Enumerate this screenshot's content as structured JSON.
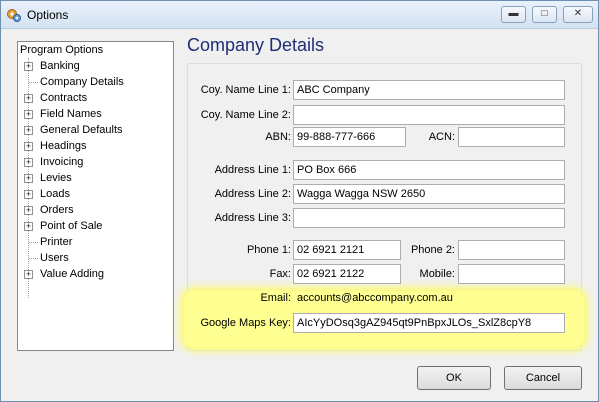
{
  "window": {
    "title": "Options"
  },
  "tree": {
    "root": "Program Options",
    "items": [
      {
        "label": "Banking",
        "expandable": true
      },
      {
        "label": "Company Details",
        "expandable": false
      },
      {
        "label": "Contracts",
        "expandable": true
      },
      {
        "label": "Field Names",
        "expandable": true
      },
      {
        "label": "General Defaults",
        "expandable": true
      },
      {
        "label": "Headings",
        "expandable": true
      },
      {
        "label": "Invoicing",
        "expandable": true
      },
      {
        "label": "Levies",
        "expandable": true
      },
      {
        "label": "Loads",
        "expandable": true
      },
      {
        "label": "Orders",
        "expandable": true
      },
      {
        "label": "Point of Sale",
        "expandable": true
      },
      {
        "label": "Printer",
        "expandable": false
      },
      {
        "label": "Users",
        "expandable": false
      },
      {
        "label": "Value Adding",
        "expandable": true
      }
    ]
  },
  "page": {
    "heading": "Company Details"
  },
  "form": {
    "name1": {
      "label": "Coy. Name Line 1:",
      "value": "ABC Company"
    },
    "name2": {
      "label": "Coy. Name Line 2:",
      "value": ""
    },
    "abn": {
      "label": "ABN:",
      "value": "99-888-777-666"
    },
    "acn": {
      "label": "ACN:",
      "value": ""
    },
    "addr1": {
      "label": "Address Line 1:",
      "value": "PO Box 666"
    },
    "addr2": {
      "label": "Address Line 2:",
      "value": "Wagga Wagga NSW 2650"
    },
    "addr3": {
      "label": "Address Line 3:",
      "value": ""
    },
    "phone1": {
      "label": "Phone 1:",
      "value": "02 6921 2121"
    },
    "phone2": {
      "label": "Phone 2:",
      "value": ""
    },
    "fax": {
      "label": "Fax:",
      "value": "02 6921 2122"
    },
    "mobile": {
      "label": "Mobile:",
      "value": ""
    },
    "email": {
      "label": "Email:",
      "value": "accounts@abccompany.com.au"
    },
    "maps": {
      "label": "Google Maps Key:",
      "value": "AIcYyDOsq3gAZ945qt9PnBpxJLOs_SxlZ8cpY8"
    }
  },
  "buttons": {
    "ok": "OK",
    "cancel": "Cancel"
  },
  "highlight_color": "#ffff92"
}
